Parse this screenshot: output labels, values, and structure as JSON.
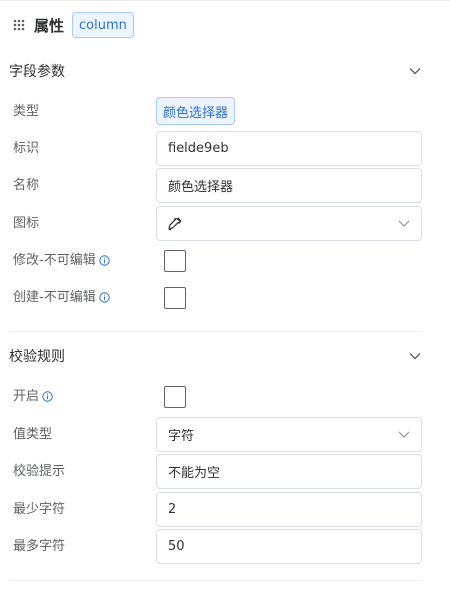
{
  "header": {
    "title": "属性",
    "tag": "column"
  },
  "field_section": {
    "title": "字段参数",
    "type_label": "类型",
    "type_value": "颜色选择器",
    "id_label": "标识",
    "id_value": "fielde9eb",
    "name_label": "名称",
    "name_value": "颜色选择器",
    "icon_label": "图标",
    "icon_value": "eyedropper-icon",
    "edit_readonly_label": "修改-不可编辑",
    "create_readonly_label": "创建-不可编辑"
  },
  "validation_section": {
    "title": "校验规则",
    "enable_label": "开启",
    "value_type_label": "值类型",
    "value_type_value": "字符",
    "hint_label": "校验提示",
    "hint_value": "不能为空",
    "min_label": "最少字符",
    "min_value": "2",
    "max_label": "最多字符",
    "max_value": "50"
  },
  "colors": {
    "accent": "#2f6fd1",
    "tag_bg": "#ecf5ff",
    "tag_border": "#a9cbf5",
    "border": "#dcdfe6"
  }
}
